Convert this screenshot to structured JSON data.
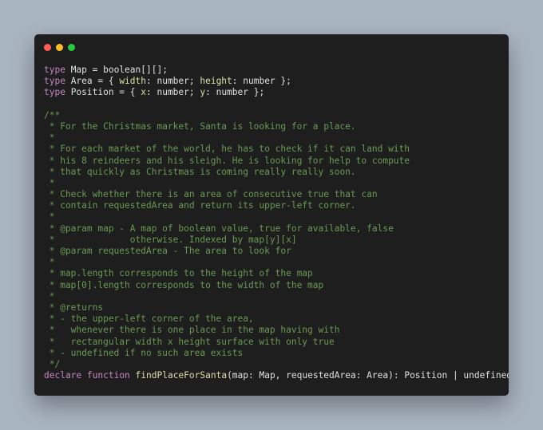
{
  "window": {
    "controls": {
      "close_color": "#ff5f56",
      "minimize_color": "#ffbd2e",
      "zoom_color": "#27c93f"
    }
  },
  "code": {
    "lines": [
      [
        [
          "keyword",
          "type"
        ],
        [
          "plain",
          " Map = boolean[][];"
        ]
      ],
      [
        [
          "keyword",
          "type"
        ],
        [
          "plain",
          " Area = { "
        ],
        [
          "prop",
          "width"
        ],
        [
          "plain",
          ": number; "
        ],
        [
          "prop",
          "height"
        ],
        [
          "plain",
          ": number };"
        ]
      ],
      [
        [
          "keyword",
          "type"
        ],
        [
          "plain",
          " Position = { "
        ],
        [
          "prop",
          "x"
        ],
        [
          "plain",
          ": number; "
        ],
        [
          "prop",
          "y"
        ],
        [
          "plain",
          ": number };"
        ]
      ],
      [
        [
          "plain",
          ""
        ]
      ],
      [
        [
          "comment",
          "/**"
        ]
      ],
      [
        [
          "comment",
          " * For the Christmas market, Santa is looking for a place."
        ]
      ],
      [
        [
          "comment",
          " *"
        ]
      ],
      [
        [
          "comment",
          " * For each market of the world, he has to check if it can land with"
        ]
      ],
      [
        [
          "comment",
          " * his 8 reindeers and his sleigh. He is looking for help to compute"
        ]
      ],
      [
        [
          "comment",
          " * that quickly as Christmas is coming really really soon."
        ]
      ],
      [
        [
          "comment",
          " *"
        ]
      ],
      [
        [
          "comment",
          " * Check whether there is an area of consecutive true that can"
        ]
      ],
      [
        [
          "comment",
          " * contain requestedArea and return its upper-left corner."
        ]
      ],
      [
        [
          "comment",
          " *"
        ]
      ],
      [
        [
          "comment",
          " * @param map - A map of boolean value, true for available, false"
        ]
      ],
      [
        [
          "comment",
          " *              otherwise. Indexed by map[y][x]"
        ]
      ],
      [
        [
          "comment",
          " * @param requestedArea - The area to look for"
        ]
      ],
      [
        [
          "comment",
          " *"
        ]
      ],
      [
        [
          "comment",
          " * map.length corresponds to the height of the map"
        ]
      ],
      [
        [
          "comment",
          " * map[0].length corresponds to the width of the map"
        ]
      ],
      [
        [
          "comment",
          " *"
        ]
      ],
      [
        [
          "comment",
          " * @returns"
        ]
      ],
      [
        [
          "comment",
          " * - the upper-left corner of the area,"
        ]
      ],
      [
        [
          "comment",
          " *   whenever there is one place in the map having with"
        ]
      ],
      [
        [
          "comment",
          " *   rectangular width x height surface with only true"
        ]
      ],
      [
        [
          "comment",
          " * - undefined if no such area exists"
        ]
      ],
      [
        [
          "comment",
          " */"
        ]
      ],
      [
        [
          "keyword",
          "declare"
        ],
        [
          "plain",
          " "
        ],
        [
          "keyword",
          "function"
        ],
        [
          "plain",
          " "
        ],
        [
          "func",
          "findPlaceForSanta"
        ],
        [
          "plain",
          "(map: Map, requestedArea: Area): Position | undefined;"
        ]
      ]
    ]
  }
}
